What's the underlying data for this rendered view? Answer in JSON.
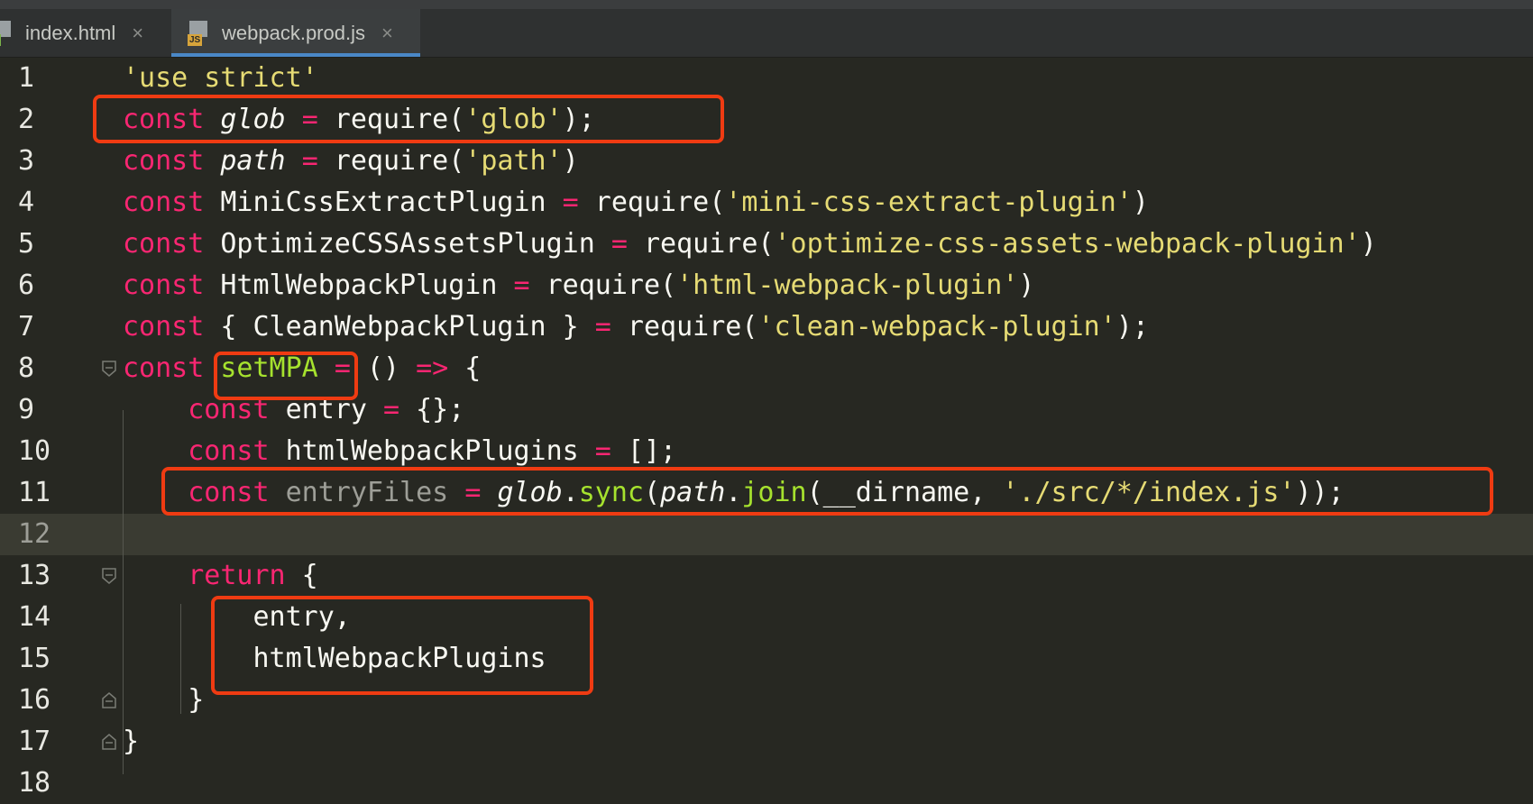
{
  "tabs": [
    {
      "label": "index.html",
      "icon": "html-file-icon",
      "icon_badge": "H",
      "active": false
    },
    {
      "label": "webpack.prod.js",
      "icon": "js-file-icon",
      "icon_badge": "JS",
      "active": true
    }
  ],
  "colors": {
    "keyword": "#f92672",
    "string": "#e6db74",
    "function": "#a6e22e",
    "plain": "#f8f8f2",
    "highlight_box": "#ef3b12",
    "background": "#272822",
    "active_tab_underline": "#4a88c7"
  },
  "editor": {
    "current_line": 12,
    "lines": [
      {
        "n": "1",
        "tokens": [
          [
            "str",
            "'use strict'"
          ]
        ]
      },
      {
        "n": "2",
        "tokens": [
          [
            "kw",
            "const"
          ],
          [
            "pl",
            " "
          ],
          [
            "it",
            "glob"
          ],
          [
            "pl",
            " "
          ],
          [
            "op",
            "="
          ],
          [
            "pl",
            " require("
          ],
          [
            "str",
            "'glob'"
          ],
          [
            "pl",
            ");"
          ]
        ]
      },
      {
        "n": "3",
        "tokens": [
          [
            "kw",
            "const"
          ],
          [
            "pl",
            " "
          ],
          [
            "it",
            "path"
          ],
          [
            "pl",
            " "
          ],
          [
            "op",
            "="
          ],
          [
            "pl",
            " require("
          ],
          [
            "str",
            "'path'"
          ],
          [
            "pl",
            ")"
          ]
        ]
      },
      {
        "n": "4",
        "tokens": [
          [
            "kw",
            "const"
          ],
          [
            "pl",
            " MiniCssExtractPlugin "
          ],
          [
            "op",
            "="
          ],
          [
            "pl",
            " require("
          ],
          [
            "str",
            "'mini-css-extract-plugin'"
          ],
          [
            "pl",
            ")"
          ]
        ]
      },
      {
        "n": "5",
        "tokens": [
          [
            "kw",
            "const"
          ],
          [
            "pl",
            " OptimizeCSSAssetsPlugin "
          ],
          [
            "op",
            "="
          ],
          [
            "pl",
            " require("
          ],
          [
            "str",
            "'optimize-css-assets-webpack-plugin'"
          ],
          [
            "pl",
            ")"
          ]
        ]
      },
      {
        "n": "6",
        "tokens": [
          [
            "kw",
            "const"
          ],
          [
            "pl",
            " HtmlWebpackPlugin "
          ],
          [
            "op",
            "="
          ],
          [
            "pl",
            " require("
          ],
          [
            "str",
            "'html-webpack-plugin'"
          ],
          [
            "pl",
            ")"
          ]
        ]
      },
      {
        "n": "7",
        "tokens": [
          [
            "kw",
            "const"
          ],
          [
            "pl",
            " { CleanWebpackPlugin } "
          ],
          [
            "op",
            "="
          ],
          [
            "pl",
            " require("
          ],
          [
            "str",
            "'clean-webpack-plugin'"
          ],
          [
            "pl",
            ");"
          ]
        ]
      },
      {
        "n": "8",
        "tokens": [
          [
            "kw",
            "const"
          ],
          [
            "pl",
            " "
          ],
          [
            "fn",
            "setMPA"
          ],
          [
            "pl",
            " "
          ],
          [
            "op",
            "="
          ],
          [
            "pl",
            " () "
          ],
          [
            "op",
            "=>"
          ],
          [
            "pl",
            " {"
          ]
        ]
      },
      {
        "n": "9",
        "tokens": [
          [
            "pl",
            "    "
          ],
          [
            "kw",
            "const"
          ],
          [
            "pl",
            " entry "
          ],
          [
            "op",
            "="
          ],
          [
            "pl",
            " {};"
          ]
        ]
      },
      {
        "n": "10",
        "tokens": [
          [
            "pl",
            "    "
          ],
          [
            "kw",
            "const"
          ],
          [
            "pl",
            " htmlWebpackPlugins "
          ],
          [
            "op",
            "="
          ],
          [
            "pl",
            " [];"
          ]
        ]
      },
      {
        "n": "11",
        "tokens": [
          [
            "pl",
            "    "
          ],
          [
            "kw",
            "const"
          ],
          [
            "pl",
            " "
          ],
          [
            "dim",
            "entryFiles"
          ],
          [
            "pl",
            " "
          ],
          [
            "op",
            "="
          ],
          [
            "pl",
            " "
          ],
          [
            "it",
            "glob"
          ],
          [
            "pl",
            "."
          ],
          [
            "fn",
            "sync"
          ],
          [
            "pl",
            "("
          ],
          [
            "it",
            "path"
          ],
          [
            "pl",
            "."
          ],
          [
            "fn",
            "join"
          ],
          [
            "pl",
            "(__dirname, "
          ],
          [
            "str",
            "'./src/*/index.js'"
          ],
          [
            "pl",
            "));"
          ]
        ]
      },
      {
        "n": "12",
        "tokens": []
      },
      {
        "n": "13",
        "tokens": [
          [
            "pl",
            "    "
          ],
          [
            "kw",
            "return"
          ],
          [
            "pl",
            " {"
          ]
        ]
      },
      {
        "n": "14",
        "tokens": [
          [
            "pl",
            "        entry,"
          ]
        ]
      },
      {
        "n": "15",
        "tokens": [
          [
            "pl",
            "        htmlWebpackPlugins"
          ]
        ]
      },
      {
        "n": "16",
        "tokens": [
          [
            "pl",
            "    }"
          ]
        ]
      },
      {
        "n": "17",
        "tokens": [
          [
            "pl",
            "}"
          ]
        ]
      },
      {
        "n": "18",
        "tokens": []
      }
    ]
  }
}
